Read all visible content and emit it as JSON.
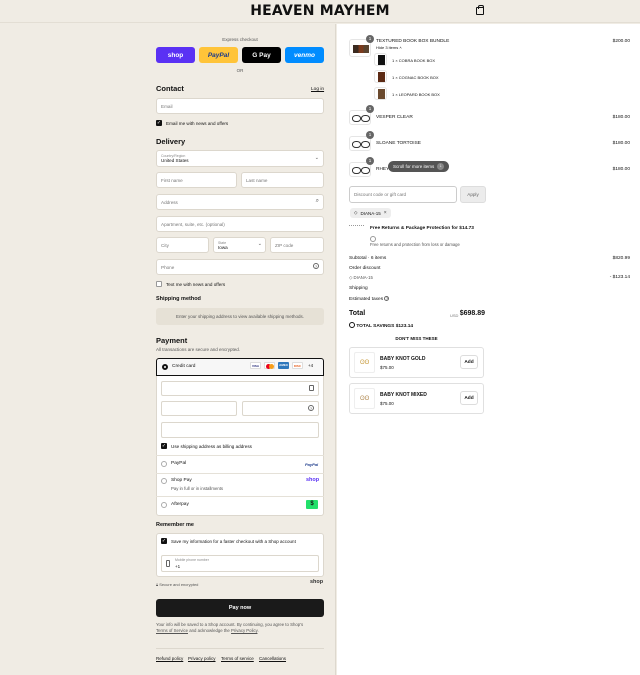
{
  "brand": "HEAVEN MAYHEM",
  "express": {
    "label": "Express checkout",
    "shop": "shop",
    "paypal": "PayPal",
    "gpay": "G Pay",
    "venmo": "venmo",
    "or": "OR"
  },
  "contact": {
    "title": "Contact",
    "login": "Log in",
    "email_placeholder": "Email",
    "news": "Email me with news and offers"
  },
  "delivery": {
    "title": "Delivery",
    "country_label": "Country/Region",
    "country": "United States",
    "first": "First name",
    "last": "Last name",
    "address": "Address",
    "apt": "Apartment, suite, etc. (optional)",
    "city": "City",
    "state_label": "State",
    "state": "Iowa",
    "zip": "ZIP code",
    "phone": "Phone",
    "text_news": "Text me with news and offers"
  },
  "shipping": {
    "title": "Shipping method",
    "note": "Enter your shipping address to view available shipping methods."
  },
  "payment": {
    "title": "Payment",
    "sub": "All transactions are secure and encrypted.",
    "credit": "Credit card",
    "more": "+4",
    "billing": "Use shipping address as billing address",
    "paypal": "PayPal",
    "paypal_logo": "PayPal",
    "shoppay": "Shop Pay",
    "shoppay_sub": "Pay in full or in installments",
    "shop_logo": "shop",
    "afterpay": "Afterpay",
    "afterpay_logo": "$",
    "cards": [
      "VISA",
      "MC",
      "AMEX",
      "DISC"
    ]
  },
  "remember": {
    "title": "Remember me",
    "save": "Save my information for a faster checkout with a Shop account",
    "mobile_label": "Mobile phone number",
    "mobile_prefix": "+1",
    "secure": "Secure and encrypted",
    "shop": "shop"
  },
  "pay_now": "Pay now",
  "legal": {
    "text1": "Your info will be saved to a Shop account. By continuing, you agree to Shop's",
    "tos": "Terms of Service",
    "and": "and acknowledge the",
    "privacy": "Privacy Policy",
    "dot": "."
  },
  "footer": [
    "Refund policy",
    "Privacy policy",
    "Terms of service",
    "Cancellations"
  ],
  "cart": {
    "bundle": {
      "qty": "1",
      "name": "TEXTURED BOOK BOX BUNDLE",
      "price": "$200.00",
      "hide": "Hide 3 items",
      "subs": [
        "1 × COBRA BOOK BOX",
        "1 × COGNAC BOOK BOX",
        "1 × LEOPARD BOOK BOX"
      ]
    },
    "items": [
      {
        "qty": "1",
        "name": "VESPER CLEAR",
        "price": "$180.00"
      },
      {
        "qty": "1",
        "name": "SLOANE TORTOISE",
        "price": "$180.00"
      },
      {
        "qty": "1",
        "name": "RHEYA",
        "price": "$180.00"
      }
    ],
    "scroll": "Scroll for more items",
    "discount_placeholder": "Discount code or gift card",
    "apply": "Apply",
    "tag": "DIANA-15",
    "protection_title": "Free Returns & Package Protection for $14.73",
    "protection_sub": "Free returns and protection from loss or damage",
    "subtotal_label": "Subtotal · 6 items",
    "subtotal": "$820.99",
    "order_discount": "Order discount",
    "code": "DIANA-15",
    "discount": "- $123.14",
    "shipping_label": "Shipping",
    "taxes_label": "Estimated taxes",
    "total_label": "Total",
    "currency": "USD",
    "total": "$698.89",
    "savings_label": "TOTAL SAVINGS",
    "savings": "$123.14",
    "dontmiss": "DON'T MISS THESE",
    "upsell": [
      {
        "name": "BABY KNOT GOLD",
        "price": "$75.00",
        "btn": "Add"
      },
      {
        "name": "BABY KNOT MIXED",
        "price": "$75.00",
        "btn": "Add"
      }
    ]
  }
}
